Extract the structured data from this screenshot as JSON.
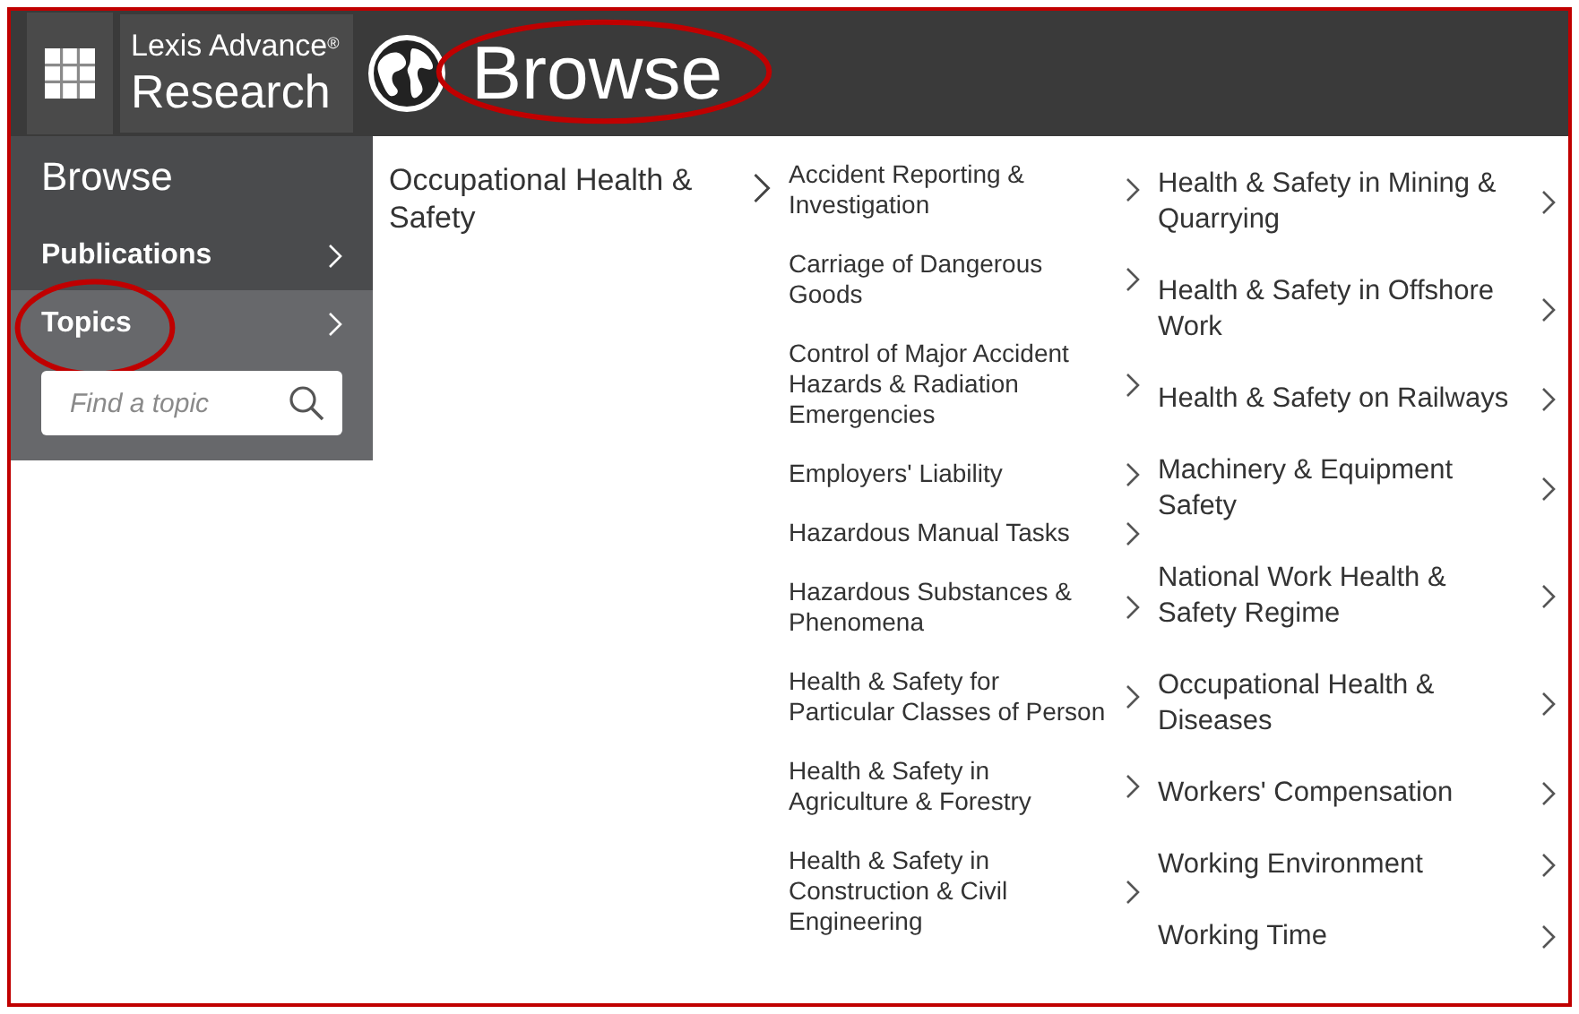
{
  "header": {
    "logo_line_1": "Lexis Advance",
    "logo_mark": "®",
    "logo_line_2": "Research",
    "title": "Browse",
    "title_circled": true
  },
  "sidebar": {
    "title": "Browse",
    "items": [
      {
        "label": "Publications",
        "selected": false,
        "circled": false
      },
      {
        "label": "Topics",
        "selected": true,
        "circled": true
      }
    ],
    "search": {
      "placeholder": "Find a topic"
    }
  },
  "category": {
    "label": "Occupational Health & Safety"
  },
  "topics_left": [
    {
      "label": "Accident Reporting & Investigation"
    },
    {
      "label": "Carriage of Dangerous Goods"
    },
    {
      "label": "Control of Major Accident Hazards & Radiation Emergencies"
    },
    {
      "label": "Employers' Liability"
    },
    {
      "label": "Hazardous Manual Tasks"
    },
    {
      "label": "Hazardous Substances & Phenomena"
    },
    {
      "label": "Health & Safety for Particular Classes of Person"
    },
    {
      "label": "Health & Safety in Agriculture & Forestry"
    },
    {
      "label": "Health & Safety in Construction & Civil Engineering"
    }
  ],
  "topics_right": [
    {
      "label": "Health & Safety in Mining & Quarrying"
    },
    {
      "label": "Health & Safety in Offshore Work"
    },
    {
      "label": "Health & Safety on Railways"
    },
    {
      "label": "Machinery & Equipment Safety"
    },
    {
      "label": "National Work Health & Safety Regime"
    },
    {
      "label": "Occupational Health & Diseases"
    },
    {
      "label": "Workers' Compensation"
    },
    {
      "label": "Working Environment"
    },
    {
      "label": "Working Time"
    }
  ]
}
